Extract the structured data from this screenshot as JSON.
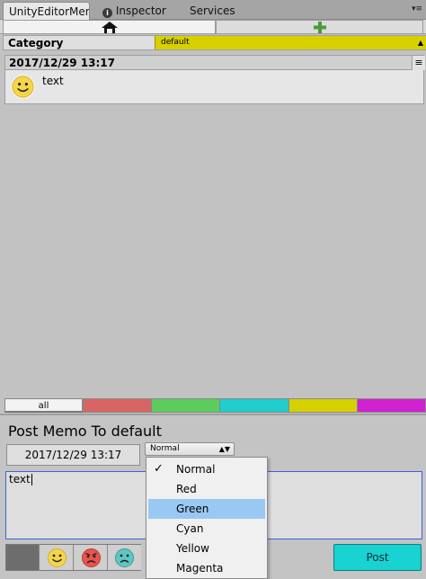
{
  "tabs": [
    {
      "label": "UnityEditorMem",
      "icon": ""
    },
    {
      "label": "Inspector",
      "icon": "info-icon"
    },
    {
      "label": "Services",
      "icon": ""
    }
  ],
  "toolbar": {
    "home_icon": "home-icon",
    "add_icon": "plus-icon",
    "add_color": "#4a9a3a"
  },
  "category": {
    "label": "Category",
    "value": "default",
    "color": "#d7d000"
  },
  "memos": [
    {
      "date": "2017/12/29 13:17",
      "text": "text",
      "face": "happy-face-icon"
    }
  ],
  "filters": [
    {
      "label": "all",
      "color": "#f3f3f3"
    },
    {
      "label": "",
      "color": "#d86464"
    },
    {
      "label": "",
      "color": "#5ccd5c"
    },
    {
      "label": "",
      "color": "#21cdcd"
    },
    {
      "label": "",
      "color": "#d7d000"
    },
    {
      "label": "",
      "color": "#d021d0"
    }
  ],
  "post": {
    "title": "Post Memo To default",
    "date": "2017/12/29 13:17",
    "color_value": "Normal",
    "text": "text",
    "button": "Post",
    "button_color": "#19d2d2"
  },
  "color_options": [
    {
      "label": "Normal",
      "checked": true,
      "highlighted": false
    },
    {
      "label": "Red",
      "checked": false,
      "highlighted": false
    },
    {
      "label": "Green",
      "checked": false,
      "highlighted": true
    },
    {
      "label": "Cyan",
      "checked": false,
      "highlighted": false
    },
    {
      "label": "Yellow",
      "checked": false,
      "highlighted": false
    },
    {
      "label": "Magenta",
      "checked": false,
      "highlighted": false
    }
  ]
}
